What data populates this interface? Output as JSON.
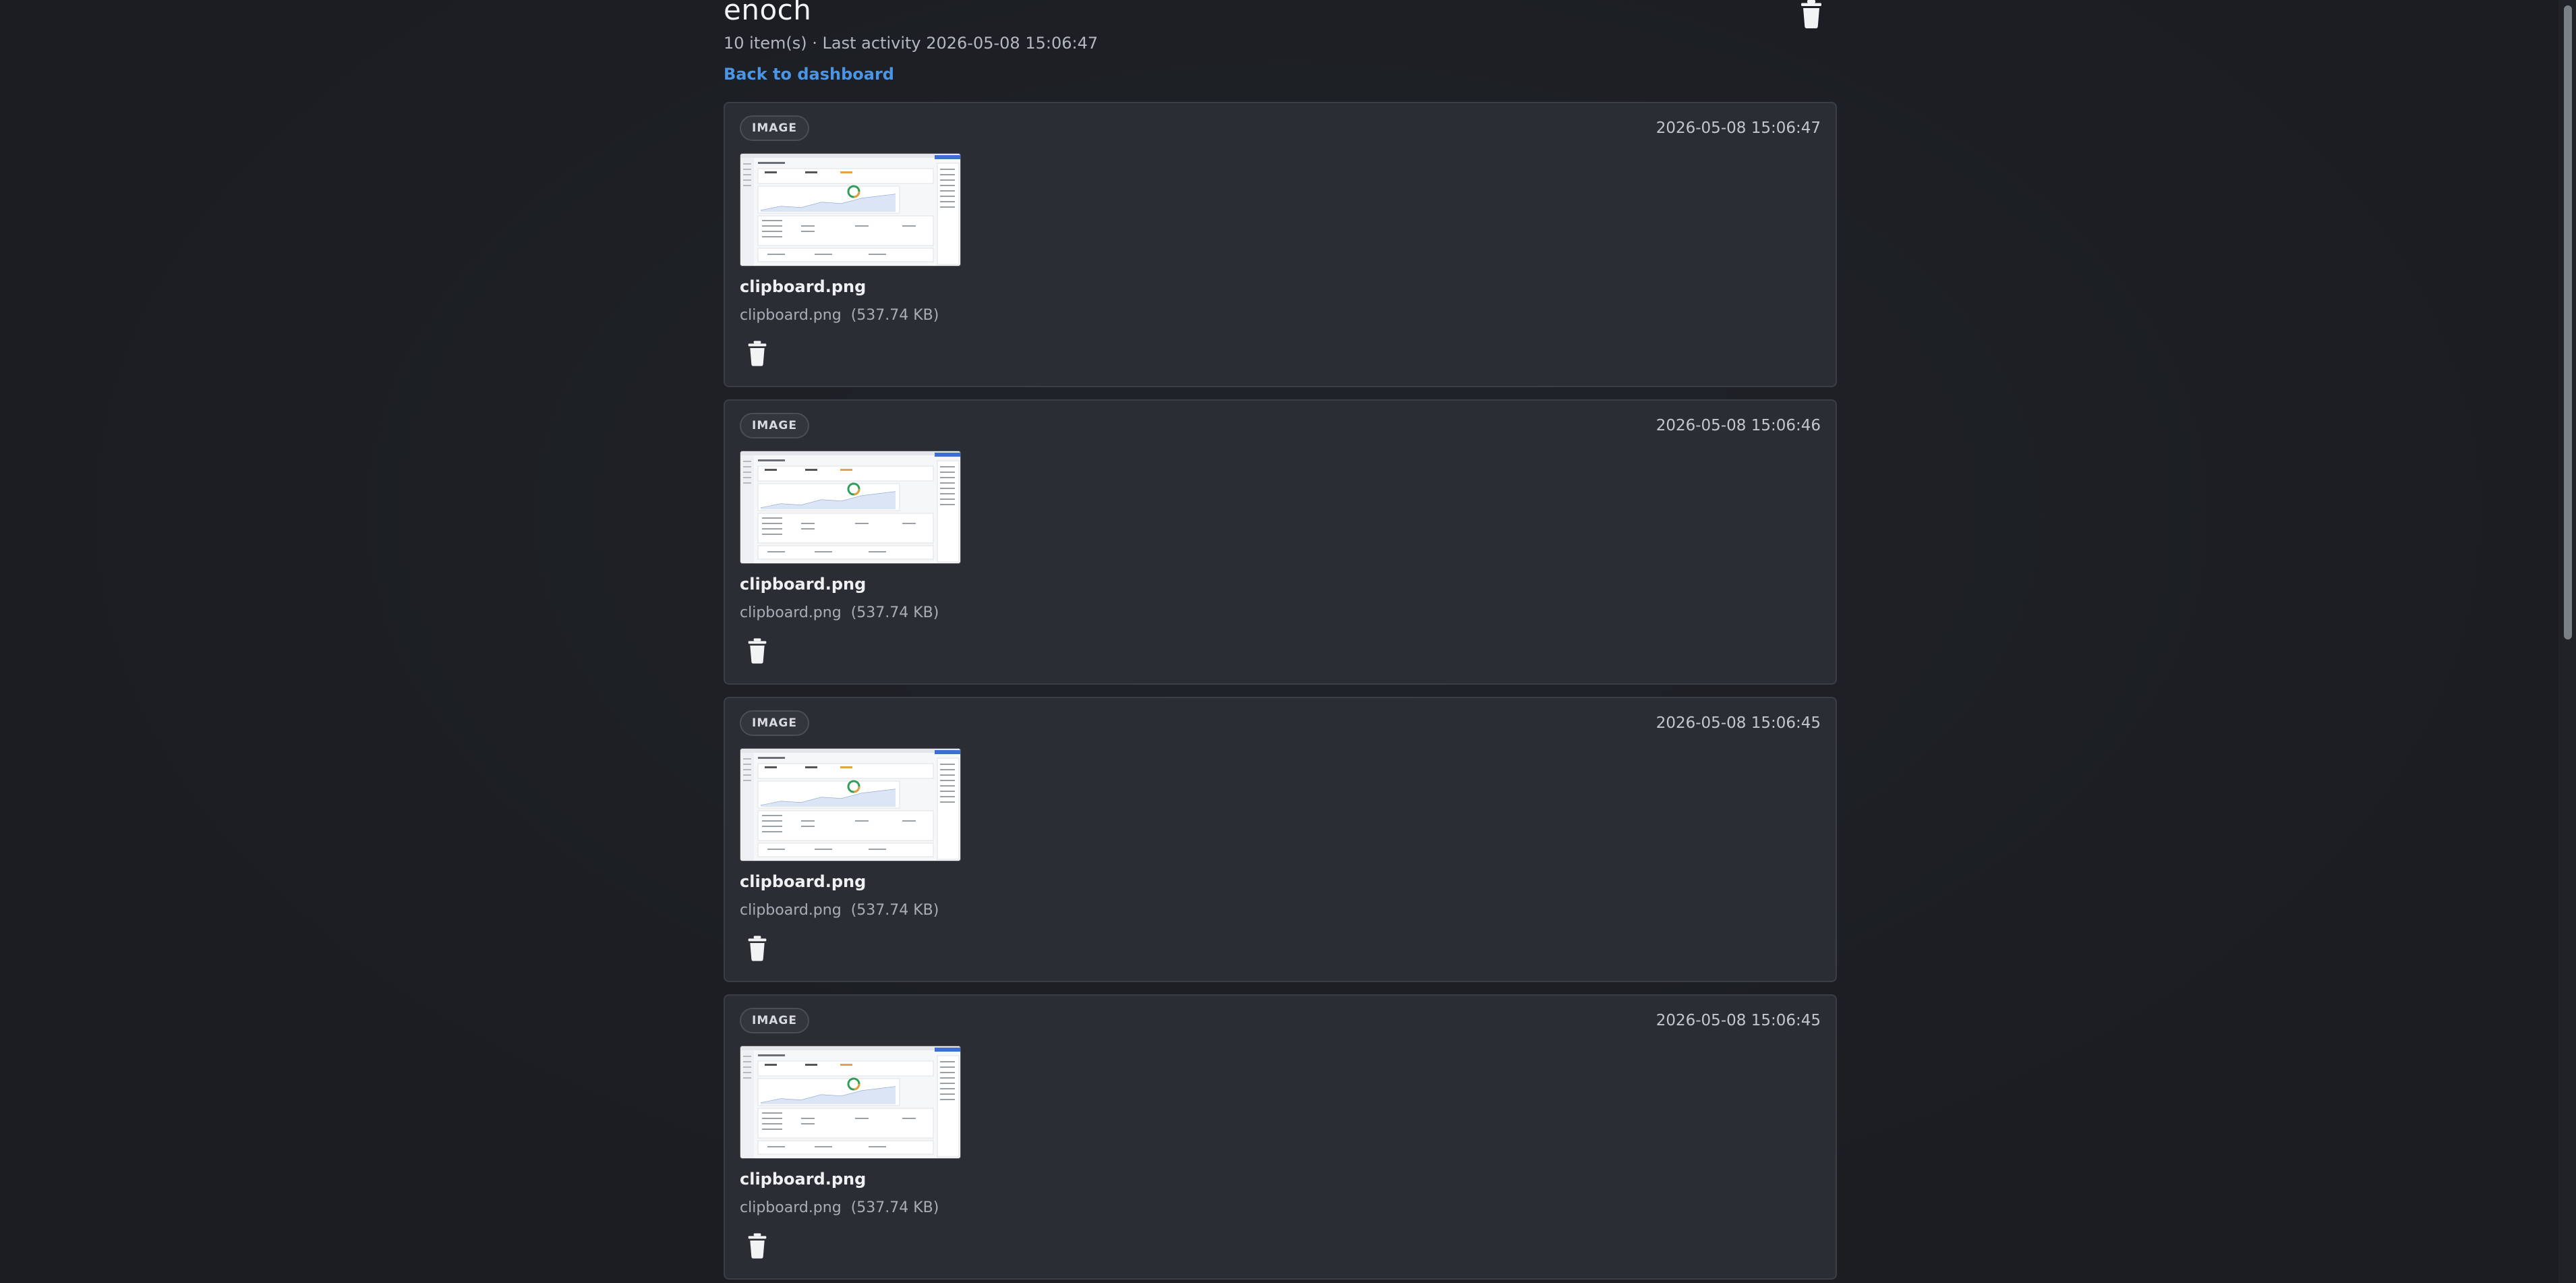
{
  "header": {
    "title": "enoch",
    "meta": "10 item(s) · Last activity 2026-05-08 15:06:47",
    "back_link": "Back to dashboard"
  },
  "items": [
    {
      "badge": "IMAGE",
      "timestamp": "2026-05-08 15:06:47",
      "title": "clipboard.png",
      "filename": "clipboard.png",
      "size": "(537.74 KB)"
    },
    {
      "badge": "IMAGE",
      "timestamp": "2026-05-08 15:06:46",
      "title": "clipboard.png",
      "filename": "clipboard.png",
      "size": "(537.74 KB)"
    },
    {
      "badge": "IMAGE",
      "timestamp": "2026-05-08 15:06:45",
      "title": "clipboard.png",
      "filename": "clipboard.png",
      "size": "(537.74 KB)"
    },
    {
      "badge": "IMAGE",
      "timestamp": "2026-05-08 15:06:45",
      "title": "clipboard.png",
      "filename": "clipboard.png",
      "size": "(537.74 KB)"
    }
  ],
  "colors": {
    "background": "#1c1e22",
    "card": "#2a2d33",
    "link": "#4a95e6"
  },
  "icons": {
    "delete": "trash-icon",
    "thumbnail": "image-thumbnail"
  }
}
